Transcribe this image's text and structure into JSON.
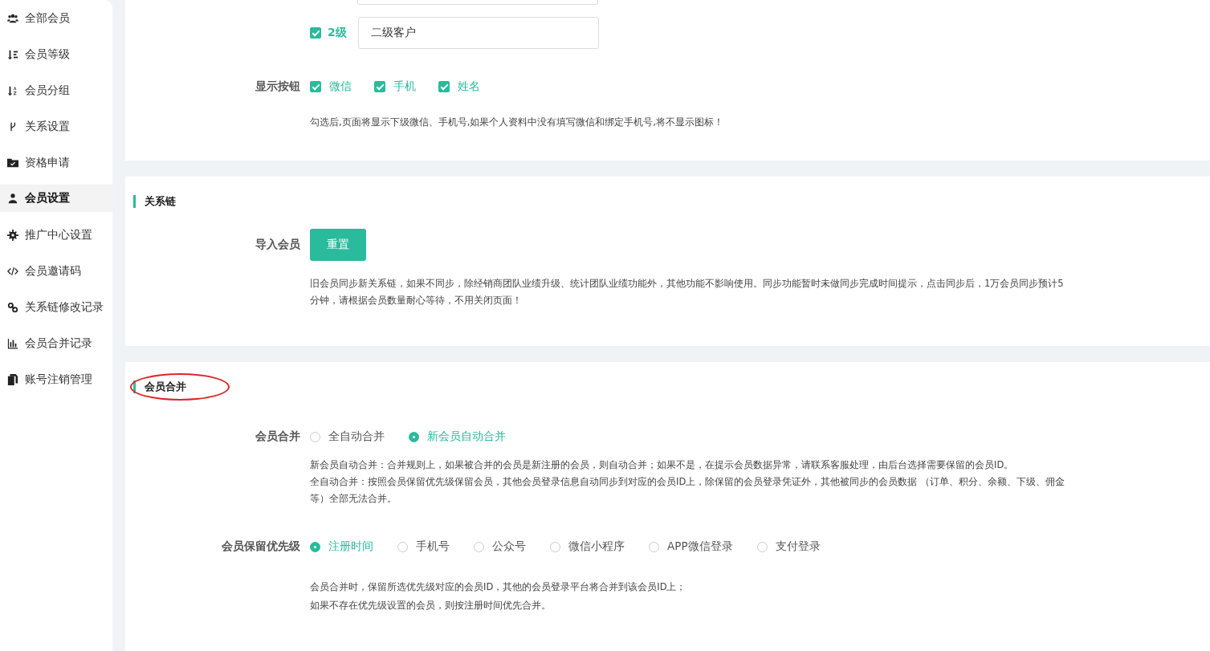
{
  "sidebar": {
    "items": [
      {
        "label": "全部会员",
        "selected": false
      },
      {
        "label": "会员等级",
        "selected": false
      },
      {
        "label": "会员分组",
        "selected": false
      },
      {
        "label": "关系设置",
        "selected": false
      },
      {
        "label": "资格申请",
        "selected": false
      },
      {
        "label": "会员设置",
        "selected": true
      },
      {
        "label": "推广中心设置",
        "selected": false
      },
      {
        "label": "会员邀请码",
        "selected": false
      },
      {
        "label": "关系链修改记录",
        "selected": false
      },
      {
        "label": "会员合并记录",
        "selected": false
      },
      {
        "label": "账号注销管理",
        "selected": false
      }
    ]
  },
  "levels_card": {
    "levels": [
      {
        "checked": true,
        "label": "2级",
        "value": "二级客户"
      }
    ],
    "display_buttons": {
      "label": "显示按钮",
      "options": [
        {
          "label": "微信",
          "checked": true
        },
        {
          "label": "手机",
          "checked": true
        },
        {
          "label": "姓名",
          "checked": true
        }
      ]
    },
    "hint": "勾选后,页面将显示下级微信、手机号,如果个人资料中没有填写微信和绑定手机号,将不显示图标！"
  },
  "relation_card": {
    "title": "关系链",
    "import": {
      "label": "导入会员",
      "button": "重置"
    },
    "hint": "旧会员同步新关系链，如果不同步，除经销商团队业绩升级、统计团队业绩功能外，其他功能不影响使用。同步功能暂时未做同步完成时间提示，点击同步后，1万会员同步预计5分钟，请根据会员数量耐心等待，不用关闭页面！"
  },
  "merge_card": {
    "title": "会员合并",
    "title_circled": true,
    "merge": {
      "label": "会员合并",
      "options": [
        {
          "label": "全自动合并",
          "selected": false
        },
        {
          "label": "新会员自动合并",
          "selected": true
        }
      ]
    },
    "merge_hints": [
      "新会员自动合并：合并规则上，如果被合并的会员是新注册的会员，则自动合并；如果不是，在提示会员数据异常，请联系客服处理，由后台选择需要保留的会员ID。",
      "全自动合并：按照会员保留优先级保留会员，其他会员登录信息自动同步到对应的会员ID上，除保留的会员登录凭证外，其他被同步的会员数据 （订单、积分、余额、下级、佣金等）全部无法合并。"
    ],
    "priority": {
      "label": "会员保留优先级",
      "options": [
        {
          "label": "注册时间",
          "selected": true
        },
        {
          "label": "手机号",
          "selected": false
        },
        {
          "label": "公众号",
          "selected": false
        },
        {
          "label": "微信小程序",
          "selected": false
        },
        {
          "label": "APP微信登录",
          "selected": false
        },
        {
          "label": "支付登录",
          "selected": false
        }
      ]
    },
    "priority_hints": [
      "会员合并时，保留所选优先级对应的会员ID，其他的会员登录平台将合并到该会员ID上；",
      "如果不存在优先级设置的会员，则按注册时间优先合并。"
    ]
  }
}
